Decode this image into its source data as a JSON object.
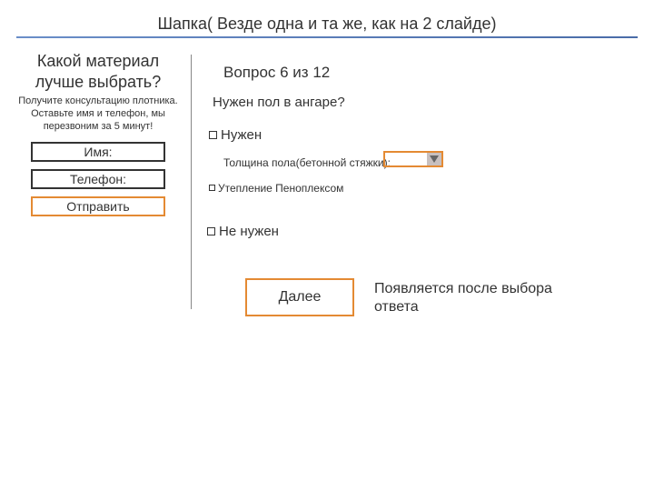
{
  "header": {
    "title": "Шапка( Везде одна и та же, как на 2 слайде)"
  },
  "lead": {
    "title": "Какой материал лучше выбрать?",
    "subtitle": "Получите консультацию плотника. Оставьте имя и телефон, мы перезвоним за 5 минут!",
    "name_label": "Имя:",
    "phone_label": "Телефон:",
    "submit_label": "Отправить"
  },
  "quiz": {
    "progress": "Вопрос 6 из 12",
    "question": "Нужен пол в ангаре?",
    "options": {
      "yes": "Нужен",
      "no": "Не нужен"
    },
    "thickness_label": "Толщина пола(бетонной стяжки):",
    "insulation_label": "Утепление Пеноплексом",
    "next_label": "Далее",
    "next_note": "Появляется после выбора ответа"
  }
}
